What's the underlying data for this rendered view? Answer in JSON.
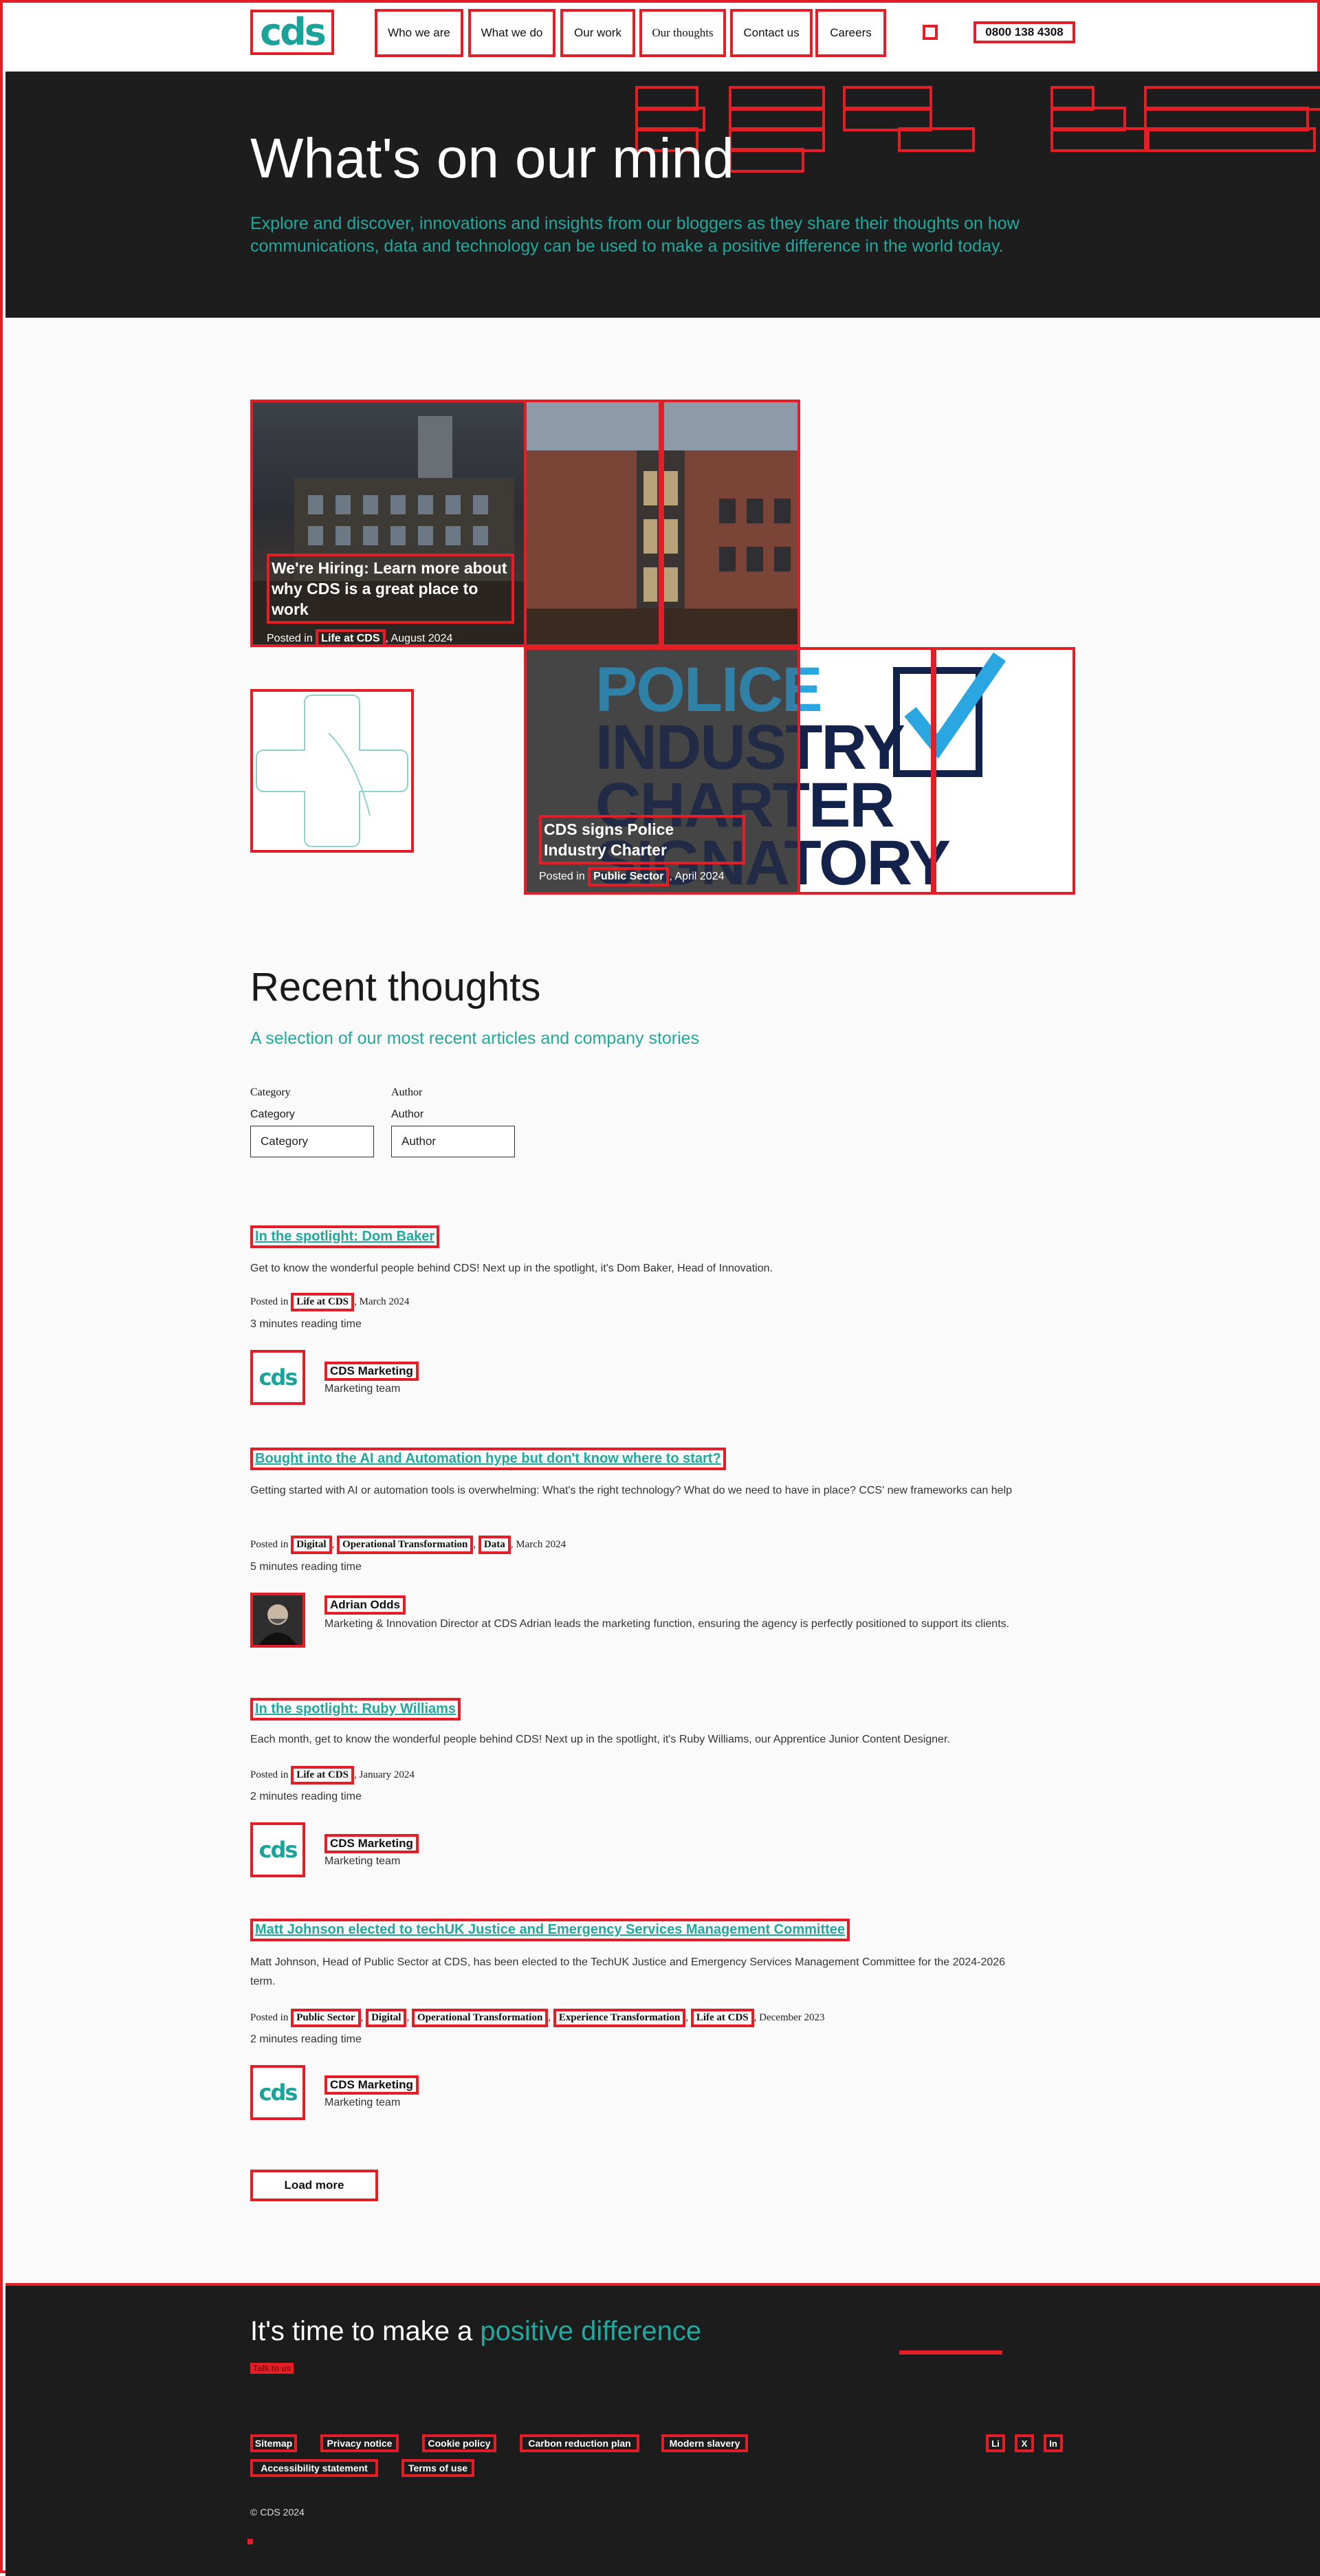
{
  "brand": {
    "logo_text": "cds",
    "accent": "#24a79d",
    "dark": "#1d1d1d"
  },
  "nav": {
    "items": [
      "Who we are",
      "What we do",
      "Our work",
      "Our thoughts",
      "Contact us",
      "Careers"
    ],
    "phone": "0800 138 4308"
  },
  "hero": {
    "title": "What's on our mind",
    "subtitle": "Explore and discover, innovations and insights from our bloggers as they share their thoughts on how communications, data and technology can be used to make a positive difference in the world today."
  },
  "featured": [
    {
      "title": "We're Hiring: Learn more about why CDS is a great place to work",
      "posted_in": "Posted in",
      "tag": "Life at CDS",
      "date": ", August 2024"
    },
    {
      "title": "CDS signs Police Industry Charter",
      "posted_in": "Posted in",
      "tag": "Public Sector",
      "date": ", April 2024",
      "image_text": [
        "POLICE",
        "INDUSTRY",
        "CHARTER",
        "SIGNATORY"
      ]
    }
  ],
  "recent": {
    "title": "Recent thoughts",
    "subtitle": "A selection of our most recent articles and company stories",
    "filters": {
      "category_label": "Category",
      "category_label2": "Category",
      "category_value": "Category",
      "author_label": "Author",
      "author_label2": "Author",
      "author_value": "Author"
    },
    "posts": [
      {
        "title": "In the spotlight: Dom Baker",
        "excerpt": "Get to know the wonderful people behind CDS! Next up in the spotlight, it's Dom Baker, Head of Innovation.",
        "posted_in": "Posted in",
        "tags": [
          "Life at CDS"
        ],
        "date": ", March 2024",
        "reading": "3 minutes reading time",
        "author": "CDS Marketing",
        "role": "Marketing team"
      },
      {
        "title": "Bought into the AI and Automation hype but don't know where to start?",
        "excerpt": "Getting started with AI or automation tools is overwhelming: What's the right technology? What do we need to have in place? CCS' new frameworks can help",
        "posted_in": "Posted in",
        "tags": [
          "Digital",
          "Operational Transformation",
          "Data"
        ],
        "date": ", March 2024",
        "reading": "5 minutes reading time",
        "author": "Adrian Odds",
        "role": "Marketing & Innovation Director at CDS Adrian leads the marketing function, ensuring the agency is perfectly positioned to support its clients."
      },
      {
        "title": "In the spotlight: Ruby Williams",
        "excerpt": "Each month, get to know the wonderful people behind CDS! Next up in the spotlight, it's Ruby Williams, our Apprentice Junior Content Designer.",
        "posted_in": "Posted in",
        "tags": [
          "Life at CDS"
        ],
        "date": ", January 2024",
        "reading": "2 minutes reading time",
        "author": "CDS Marketing",
        "role": "Marketing team"
      },
      {
        "title": "Matt Johnson elected to techUK Justice and Emergency Services Management Committee",
        "excerpt": "Matt Johnson, Head of Public Sector at CDS, has been elected to the TechUK Justice and Emergency Services Management Committee for the 2024-2026 term.",
        "posted_in": "Posted in",
        "tags": [
          "Public Sector",
          "Digital",
          "Operational Transformation",
          "Experience Transformation",
          "Life at CDS"
        ],
        "date": ", December 2023",
        "reading": "2 minutes reading time",
        "author": "CDS Marketing",
        "role": "Marketing team"
      }
    ],
    "load_more": "Load more"
  },
  "footer": {
    "cta_prefix": "It's time to make a ",
    "cta_highlight": "positive difference",
    "cta_link": "Talk to us",
    "links_row1": [
      "Sitemap",
      "Privacy notice",
      "Cookie policy",
      "Carbon reduction plan",
      "Modern slavery"
    ],
    "links_row2": [
      "Accessibility statement",
      "Terms of use"
    ],
    "social": [
      "Li",
      "X",
      "In"
    ],
    "copyright": "© CDS 2024"
  }
}
